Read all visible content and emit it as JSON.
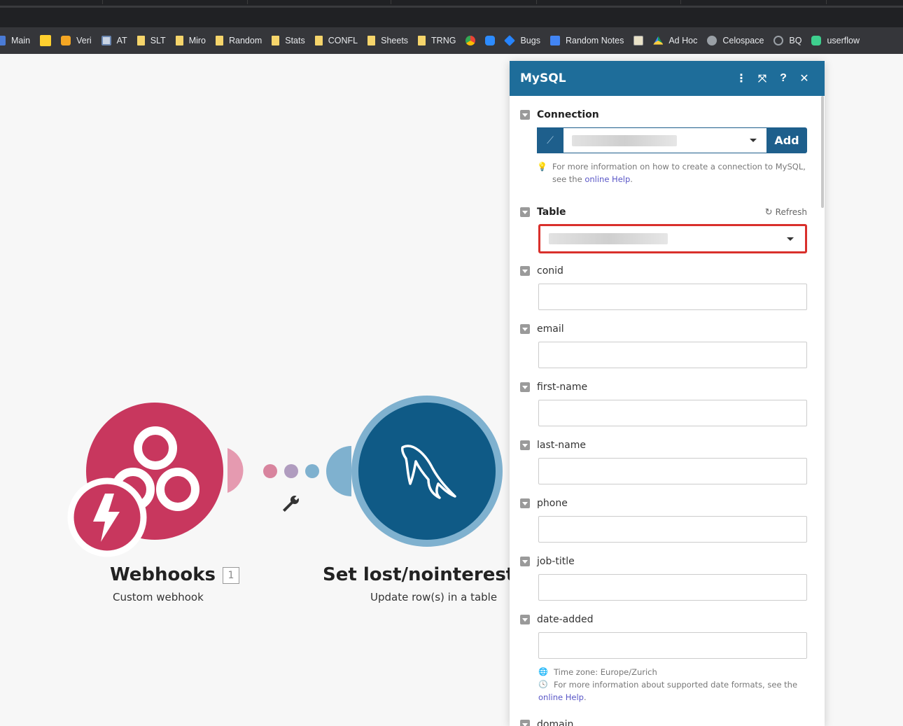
{
  "bookmarks": [
    {
      "label": "Main",
      "icon": "blue-app-icon"
    },
    {
      "label": "",
      "icon": "miro-logo-icon"
    },
    {
      "label": "Veri",
      "icon": "lightbulb-icon"
    },
    {
      "label": "AT",
      "icon": "monitor-icon"
    },
    {
      "label": "SLT",
      "icon": "folder-icon"
    },
    {
      "label": "Miro",
      "icon": "folder-icon"
    },
    {
      "label": "Random",
      "icon": "folder-icon"
    },
    {
      "label": "Stats",
      "icon": "folder-icon"
    },
    {
      "label": "CONFL",
      "icon": "folder-icon"
    },
    {
      "label": "Sheets",
      "icon": "folder-icon"
    },
    {
      "label": "TRNG",
      "icon": "folder-icon"
    },
    {
      "label": "",
      "icon": "chrome-app-icon"
    },
    {
      "label": "",
      "icon": "zoom-icon"
    },
    {
      "label": "Bugs",
      "icon": "jira-icon"
    },
    {
      "label": "Random Notes",
      "icon": "google-docs-icon"
    },
    {
      "label": "",
      "icon": "notepad-icon"
    },
    {
      "label": "Ad Hoc",
      "icon": "google-drive-icon"
    },
    {
      "label": "Celospace",
      "icon": "globe-icon"
    },
    {
      "label": "BQ",
      "icon": "gear-icon"
    },
    {
      "label": "userflow",
      "icon": "userflow-icon"
    }
  ],
  "canvas": {
    "webhook_module": {
      "title": "Webhooks",
      "counter": "1",
      "subtitle": "Custom webhook"
    },
    "mysql_module": {
      "title": "Set lost/nointerest in ",
      "subtitle": "Update row(s) in a table"
    }
  },
  "panel": {
    "title": "MySQL",
    "connection": {
      "label": "Connection",
      "add_label": "Add",
      "hint_text": "For more information on how to create a connection to MySQL, see the ",
      "hint_link": "online Help",
      "hint_end": "."
    },
    "table": {
      "label": "Table",
      "refresh_label": "Refresh"
    },
    "fields": [
      {
        "label": "conid",
        "value": ""
      },
      {
        "label": "email",
        "value": ""
      },
      {
        "label": "first-name",
        "value": ""
      },
      {
        "label": "last-name",
        "value": ""
      },
      {
        "label": "phone",
        "value": ""
      },
      {
        "label": "job-title",
        "value": ""
      },
      {
        "label": "date-added",
        "value": ""
      }
    ],
    "date_hints": {
      "timezone": "Time zone: Europe/Zurich",
      "formats_text": "For more information about supported date formats, see the",
      "formats_link": "online Help",
      "formats_end": "."
    },
    "last_field": {
      "label": "domain"
    }
  },
  "colors": {
    "panel_header": "#1e6d9a",
    "webhook_module": "#c8375e",
    "mysql_module": "#0f5a86",
    "highlight_border": "#d9302c"
  }
}
